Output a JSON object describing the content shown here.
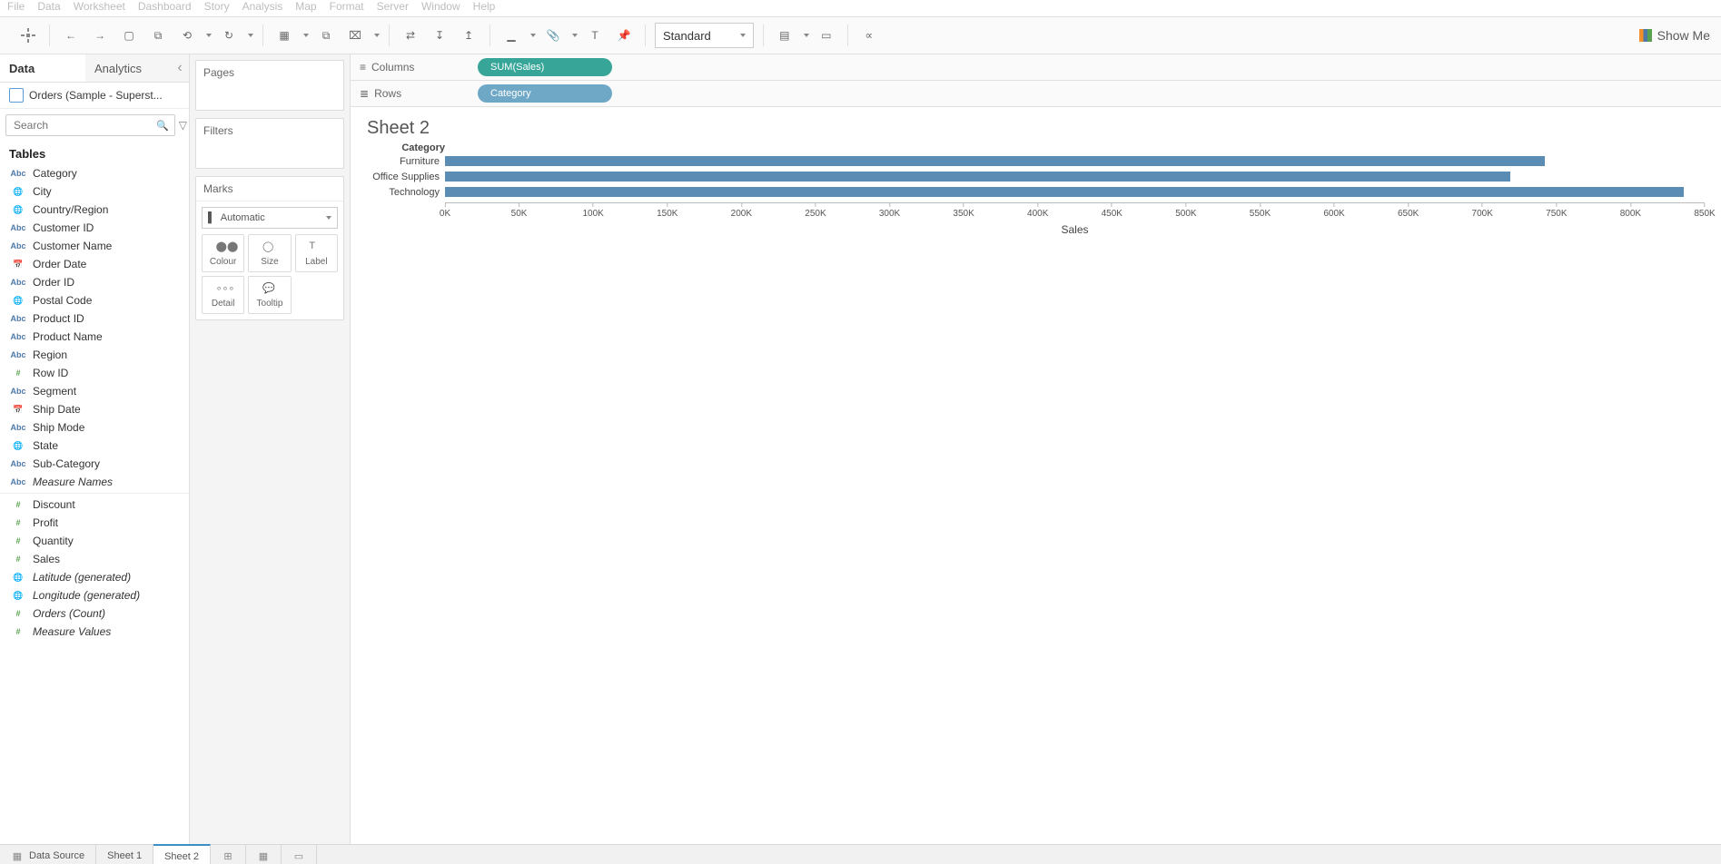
{
  "menu": [
    "File",
    "Data",
    "Worksheet",
    "Dashboard",
    "Story",
    "Analysis",
    "Map",
    "Format",
    "Server",
    "Window",
    "Help"
  ],
  "toolbar": {
    "fit_mode": "Standard",
    "show_me": "Show Me"
  },
  "sidebar": {
    "tabs": {
      "data": "Data",
      "analytics": "Analytics"
    },
    "datasource": "Orders (Sample - Superst...",
    "search_placeholder": "Search",
    "tables_header": "Tables",
    "fields": [
      {
        "icon": "abc",
        "label": "Category"
      },
      {
        "icon": "globe",
        "label": "City"
      },
      {
        "icon": "globe",
        "label": "Country/Region"
      },
      {
        "icon": "abc",
        "label": "Customer ID"
      },
      {
        "icon": "abc",
        "label": "Customer Name"
      },
      {
        "icon": "date",
        "label": "Order Date"
      },
      {
        "icon": "abc",
        "label": "Order ID"
      },
      {
        "icon": "globe",
        "label": "Postal Code"
      },
      {
        "icon": "abc",
        "label": "Product ID"
      },
      {
        "icon": "abc",
        "label": "Product Name"
      },
      {
        "icon": "abc",
        "label": "Region"
      },
      {
        "icon": "hash",
        "label": "Row ID"
      },
      {
        "icon": "abc",
        "label": "Segment"
      },
      {
        "icon": "date",
        "label": "Ship Date"
      },
      {
        "icon": "abc",
        "label": "Ship Mode"
      },
      {
        "icon": "globe",
        "label": "State"
      },
      {
        "icon": "abc",
        "label": "Sub-Category"
      },
      {
        "icon": "abc",
        "label": "Measure Names",
        "italic": true
      },
      {
        "icon": "hash",
        "label": "Discount",
        "divider": true
      },
      {
        "icon": "hash",
        "label": "Profit"
      },
      {
        "icon": "hash",
        "label": "Quantity"
      },
      {
        "icon": "hash",
        "label": "Sales"
      },
      {
        "icon": "globe",
        "label": "Latitude (generated)",
        "italic": true
      },
      {
        "icon": "globe",
        "label": "Longitude (generated)",
        "italic": true
      },
      {
        "icon": "hash",
        "label": "Orders (Count)",
        "italic": true
      },
      {
        "icon": "hash",
        "label": "Measure Values",
        "italic": true
      }
    ]
  },
  "cards": {
    "pages": "Pages",
    "filters": "Filters",
    "marks": "Marks",
    "mark_type": "Automatic",
    "cells": [
      "Colour",
      "Size",
      "Label",
      "Detail",
      "Tooltip"
    ]
  },
  "shelves": {
    "columns_label": "Columns",
    "rows_label": "Rows",
    "columns_pill": "SUM(Sales)",
    "rows_pill": "Category"
  },
  "view": {
    "title": "Sheet 2",
    "category_header": "Category",
    "axis_title": "Sales"
  },
  "chart_data": {
    "type": "bar",
    "orientation": "horizontal",
    "categories": [
      "Furniture",
      "Office Supplies",
      "Technology"
    ],
    "values": [
      742000,
      719000,
      836000
    ],
    "xlabel": "Sales",
    "ylabel": "Category",
    "xlim": [
      0,
      850000
    ],
    "ticks": [
      0,
      50000,
      100000,
      150000,
      200000,
      250000,
      300000,
      350000,
      400000,
      450000,
      500000,
      550000,
      600000,
      650000,
      700000,
      750000,
      800000,
      850000
    ],
    "tick_labels": [
      "0K",
      "50K",
      "100K",
      "150K",
      "200K",
      "250K",
      "300K",
      "350K",
      "400K",
      "450K",
      "500K",
      "550K",
      "600K",
      "650K",
      "700K",
      "750K",
      "800K",
      "850K"
    ]
  },
  "bottom_tabs": {
    "datasource": "Data Source",
    "sheets": [
      "Sheet 1",
      "Sheet 2"
    ],
    "active": "Sheet 2"
  }
}
